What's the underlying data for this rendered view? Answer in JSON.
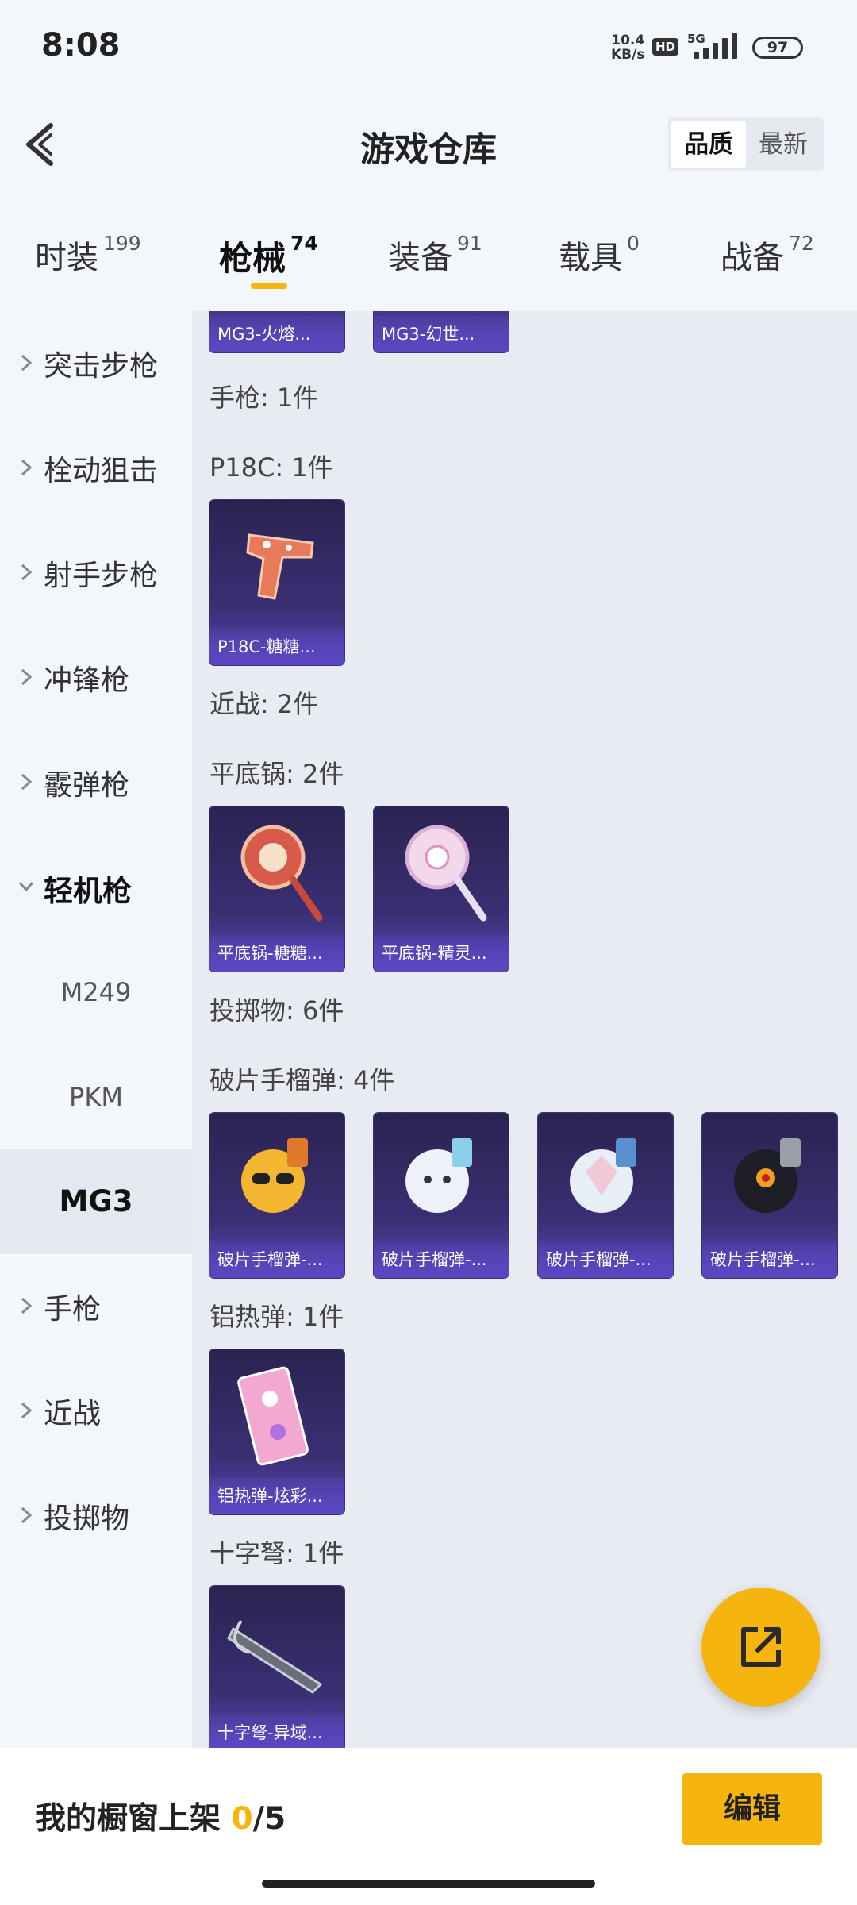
{
  "status_bar": {
    "time": "8:08",
    "net_speed_value": "10.4",
    "net_speed_unit": "KB/s",
    "hd": "HD",
    "network": "5G",
    "battery": "97"
  },
  "header": {
    "title": "游戏仓库",
    "sort_options": [
      "品质",
      "最新"
    ],
    "sort_selected": "品质"
  },
  "tabs": [
    {
      "label": "时装",
      "count": "199"
    },
    {
      "label": "枪械",
      "count": "74",
      "active": true
    },
    {
      "label": "装备",
      "count": "91"
    },
    {
      "label": "载具",
      "count": "0"
    },
    {
      "label": "战备",
      "count": "72"
    }
  ],
  "sidebar": {
    "items": [
      "突击步枪",
      "栓动狙击",
      "射手步枪",
      "冲锋枪",
      "霰弹枪",
      "轻机枪",
      "手枪",
      "近战",
      "投掷物"
    ],
    "expanded": "轻机枪",
    "sub_items": [
      "M249",
      "PKM",
      "MG3"
    ],
    "selected_sub": "MG3"
  },
  "content": {
    "top_cards": [
      "MG3-火熔...",
      "MG3-幻世..."
    ],
    "groups": [
      {
        "label": "手枪: 1件"
      },
      {
        "label": "P18C: 1件",
        "cards": [
          "P18C-糖糖..."
        ]
      },
      {
        "label": "近战: 2件"
      },
      {
        "label": "平底锅: 2件",
        "cards": [
          "平底锅-糖糖...",
          "平底锅-精灵..."
        ]
      },
      {
        "label": "投掷物: 6件"
      },
      {
        "label": "破片手榴弹: 4件",
        "cards": [
          "破片手榴弹-...",
          "破片手榴弹-...",
          "破片手榴弹-...",
          "破片手榴弹-..."
        ]
      },
      {
        "label": "铝热弹: 1件",
        "cards": [
          "铝热弹-炫彩..."
        ]
      },
      {
        "label": "十字弩: 1件",
        "cards": [
          "十字弩-异域..."
        ]
      }
    ]
  },
  "bottom_bar": {
    "showcase_label": "我的橱窗上架",
    "showcase_count": "0",
    "showcase_total": "/5",
    "edit_label": "编辑"
  },
  "colors": {
    "accent": "#f6b40e",
    "card_bg": "#3b2f74",
    "card_caption": "#5b46c1"
  }
}
